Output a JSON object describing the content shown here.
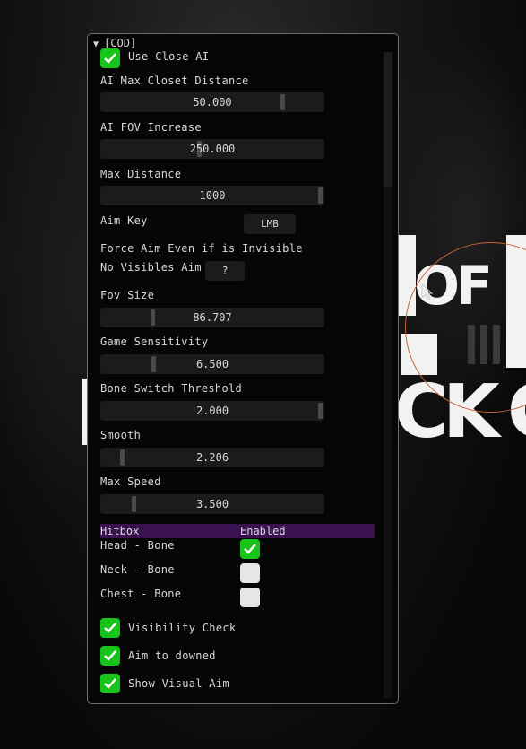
{
  "window": {
    "title": "[COD]",
    "collapse_icon": "triangle-down-icon"
  },
  "background": {
    "fragment_top": "OF",
    "fragment_bottom": "CK",
    "fragment_right": "C"
  },
  "settings": {
    "use_close_ai": {
      "label": "Use Close AI",
      "checked": true
    },
    "ai_max_closet_distance": {
      "label": "AI Max Closet Distance",
      "value": "50.000"
    },
    "ai_fov_increase": {
      "label": "AI FOV Increase",
      "value": "250.000"
    },
    "max_distance": {
      "label": "Max Distance",
      "value": "1000"
    },
    "aim_key": {
      "label": "Aim Key",
      "button": "LMB"
    },
    "force_aim": {
      "label": "Force Aim Even if is Invisible"
    },
    "no_visibles_aim": {
      "label": "No Visibles Aim",
      "button": "?"
    },
    "fov_size": {
      "label": "Fov Size",
      "value": "86.707"
    },
    "game_sensitivity": {
      "label": "Game Sensitivity",
      "value": "6.500"
    },
    "bone_switch_threshold": {
      "label": "Bone Switch Threshold",
      "value": "2.000"
    },
    "smooth": {
      "label": "Smooth",
      "value": "2.206"
    },
    "max_speed": {
      "label": "Max Speed",
      "value": "3.500"
    }
  },
  "hitbox": {
    "header": {
      "col1": "Hitbox",
      "col2": "Enabled"
    },
    "rows": [
      {
        "label": "Head - Bone",
        "checked": true
      },
      {
        "label": "Neck - Bone",
        "checked": false
      },
      {
        "label": "Chest - Bone",
        "checked": false
      }
    ]
  },
  "checks": [
    {
      "label": "Visibility Check",
      "checked": true
    },
    {
      "label": "Aim to downed",
      "checked": true
    },
    {
      "label": "Show Visual Aim",
      "checked": true
    }
  ],
  "colors": {
    "checkbox_on": "#17c41a",
    "checkbox_off": "#e6e6e6",
    "hitbox_header": "#3a1250",
    "window_border": "#6e6e6e",
    "fov_circle": "#c8603a"
  }
}
